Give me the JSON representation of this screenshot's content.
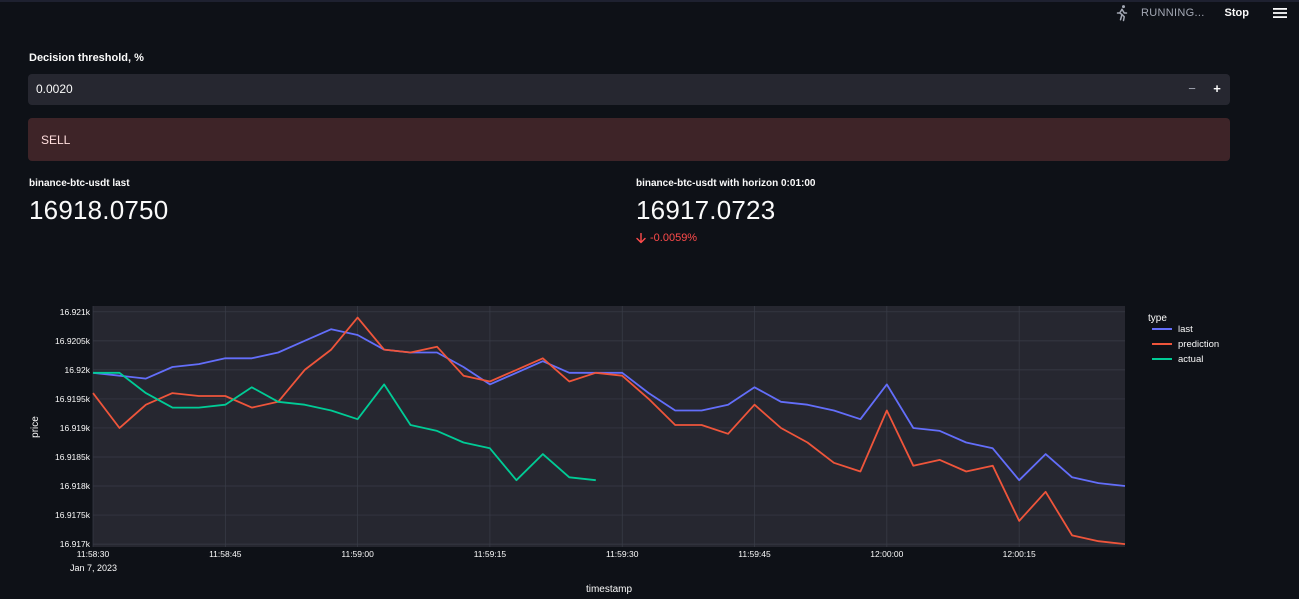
{
  "header": {
    "running_label": "RUNNING...",
    "stop_label": "Stop",
    "icons": [
      "running-man-icon",
      "hamburger-menu-icon"
    ]
  },
  "threshold": {
    "label": "Decision threshold, %",
    "value": "0.0020",
    "decrement": "−",
    "increment": "+"
  },
  "alert": {
    "text": "SELL",
    "color": "#3e2428"
  },
  "metric_last": {
    "label": "binance-btc-usdt last",
    "value": "16918.0750"
  },
  "metric_pred": {
    "label": "binance-btc-usdt with horizon 0:01:00",
    "value": "16917.0723",
    "delta": "-0.0059%",
    "delta_color": "#ff4b4b"
  },
  "chart_data": {
    "type": "line",
    "xlabel": "timestamp",
    "ylabel": "price",
    "legend_title": "type",
    "legend_position": "top-right",
    "grid": true,
    "x_ticks": [
      "11:58:30",
      "11:58:45",
      "11:59:00",
      "11:59:15",
      "11:59:30",
      "11:59:45",
      "12:00:00",
      "12:00:15"
    ],
    "x_tick_sub": "Jan 7, 2023",
    "y_ticks": [
      "16.917k",
      "16.9175k",
      "16.918k",
      "16.9185k",
      "16.919k",
      "16.9195k",
      "16.92k",
      "16.9205k",
      "16.921k"
    ],
    "xlim_seconds": [
      0,
      117
    ],
    "ylim": [
      16916.95,
      16921.1
    ],
    "series": [
      {
        "name": "last",
        "color": "#636efa",
        "x": [
          0,
          3,
          6,
          9,
          12,
          15,
          18,
          21,
          24,
          27,
          30,
          33,
          36,
          39,
          42,
          45,
          48,
          51,
          54,
          57,
          60,
          63,
          66,
          69,
          72,
          75,
          78,
          81,
          84,
          87,
          90,
          93,
          96,
          99,
          102,
          105,
          108,
          111,
          114,
          117
        ],
        "y": [
          16919.95,
          16919.9,
          16919.85,
          16920.05,
          16920.1,
          16920.2,
          16920.2,
          16920.3,
          16920.5,
          16920.7,
          16920.6,
          16920.35,
          16920.3,
          16920.3,
          16920.05,
          16919.75,
          16919.95,
          16920.15,
          16919.95,
          16919.95,
          16919.95,
          16919.6,
          16919.3,
          16919.3,
          16919.4,
          16919.7,
          16919.45,
          16919.4,
          16919.3,
          16919.15,
          16919.75,
          16919.0,
          16918.95,
          16918.75,
          16918.65,
          16918.1,
          16918.55,
          16918.15,
          16918.05,
          16918.0
        ]
      },
      {
        "name": "prediction",
        "color": "#ef553b",
        "x": [
          0,
          3,
          6,
          9,
          12,
          15,
          18,
          21,
          24,
          27,
          30,
          33,
          36,
          39,
          42,
          45,
          48,
          51,
          54,
          57,
          60,
          63,
          66,
          69,
          72,
          75,
          78,
          81,
          84,
          87,
          90,
          93,
          96,
          99,
          102,
          105,
          108,
          111,
          114,
          117
        ],
        "y": [
          16919.6,
          16919.0,
          16919.4,
          16919.6,
          16919.55,
          16919.55,
          16919.35,
          16919.45,
          16920.0,
          16920.35,
          16920.9,
          16920.35,
          16920.3,
          16920.4,
          16919.9,
          16919.8,
          16920.0,
          16920.2,
          16919.8,
          16919.95,
          16919.9,
          16919.5,
          16919.05,
          16919.05,
          16918.9,
          16919.4,
          16919.0,
          16918.75,
          16918.4,
          16918.25,
          16919.3,
          16918.35,
          16918.45,
          16918.25,
          16918.35,
          16917.4,
          16917.9,
          16917.15,
          16917.05,
          16917.0
        ]
      },
      {
        "name": "actual",
        "color": "#00cc96",
        "x": [
          0,
          3,
          6,
          9,
          12,
          15,
          18,
          21,
          24,
          27,
          30,
          33,
          36,
          39,
          42,
          45,
          48,
          51,
          54,
          57
        ],
        "y": [
          16919.95,
          16919.95,
          16919.6,
          16919.35,
          16919.35,
          16919.4,
          16919.7,
          16919.45,
          16919.4,
          16919.3,
          16919.15,
          16919.75,
          16919.05,
          16918.95,
          16918.75,
          16918.65,
          16918.1,
          16918.55,
          16918.15,
          16918.1
        ]
      }
    ]
  }
}
